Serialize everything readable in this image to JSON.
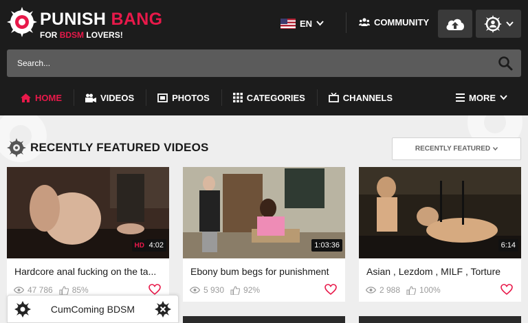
{
  "brand": {
    "title_part1": "PUNISH",
    "title_part2": "BANG",
    "tagline_part1": "FOR",
    "tagline_part2": "BDSM",
    "tagline_part3": "LOVERS!",
    "accent_color": "#e8194a"
  },
  "header": {
    "language": "EN",
    "community_label": "COMMUNITY"
  },
  "search": {
    "placeholder": "Search..."
  },
  "nav": {
    "items": [
      {
        "label": "HOME",
        "icon": "home-icon",
        "active": true
      },
      {
        "label": "VIDEOS",
        "icon": "video-camera-icon"
      },
      {
        "label": "PHOTOS",
        "icon": "photos-icon"
      },
      {
        "label": "CATEGORIES",
        "icon": "grid-icon"
      },
      {
        "label": "CHANNELS",
        "icon": "tv-icon"
      }
    ],
    "more_label": "MORE"
  },
  "section": {
    "title": "RECENTLY FEATURED VIDEOS",
    "sort_label": "RECENTLY FEATURED"
  },
  "videos": [
    {
      "title": "Hardcore anal fucking on the ta...",
      "duration": "4:02",
      "hd": "HD",
      "views": "47 786",
      "rating": "85%"
    },
    {
      "title": "Ebony bum begs for punishment",
      "duration": "1:03:36",
      "views": "5 930",
      "rating": "92%"
    },
    {
      "title": "Asian , Lezdom , MILF , Torture",
      "duration": "6:14",
      "views": "2 988",
      "rating": "100%"
    }
  ],
  "toast": {
    "label": "CumComing BDSM"
  }
}
